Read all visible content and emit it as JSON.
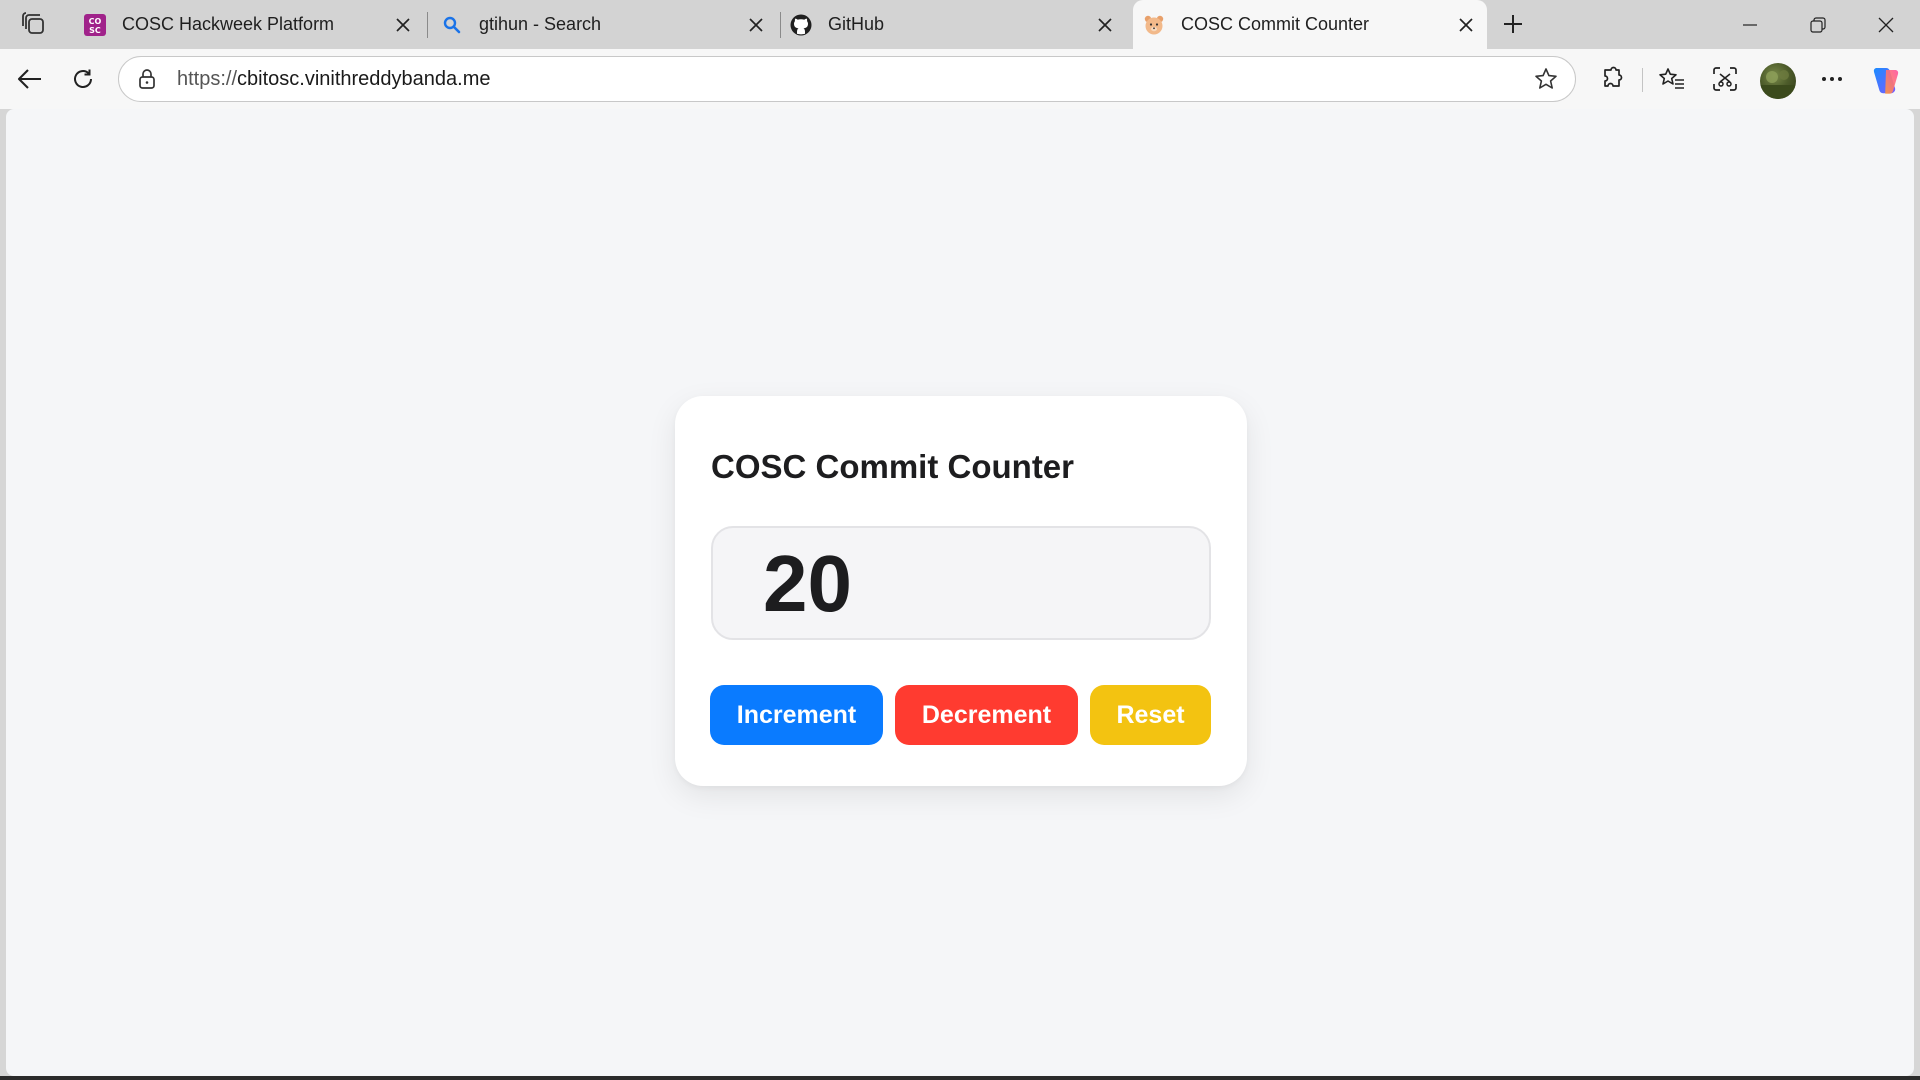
{
  "browser": {
    "tabs": [
      {
        "title": "COSC Hackweek Platform",
        "favicon": "cosc-logo-icon",
        "active": false
      },
      {
        "title": "gtihun - Search",
        "favicon": "search-icon",
        "active": false
      },
      {
        "title": "GitHub",
        "favicon": "github-icon",
        "active": false
      },
      {
        "title": "COSC Commit Counter",
        "favicon": "bear-icon",
        "active": true
      }
    ],
    "url": {
      "protocol": "https://",
      "host": "cbitosc.vinithreddybanda.me"
    }
  },
  "app": {
    "title": "COSC Commit Counter",
    "count": "20",
    "buttons": {
      "increment": "Increment",
      "decrement": "Decrement",
      "reset": "Reset"
    }
  },
  "colors": {
    "increment": "#0a7bff",
    "decrement": "#ff3b30",
    "reset": "#f3c311",
    "page_bg": "#f5f6f8"
  }
}
